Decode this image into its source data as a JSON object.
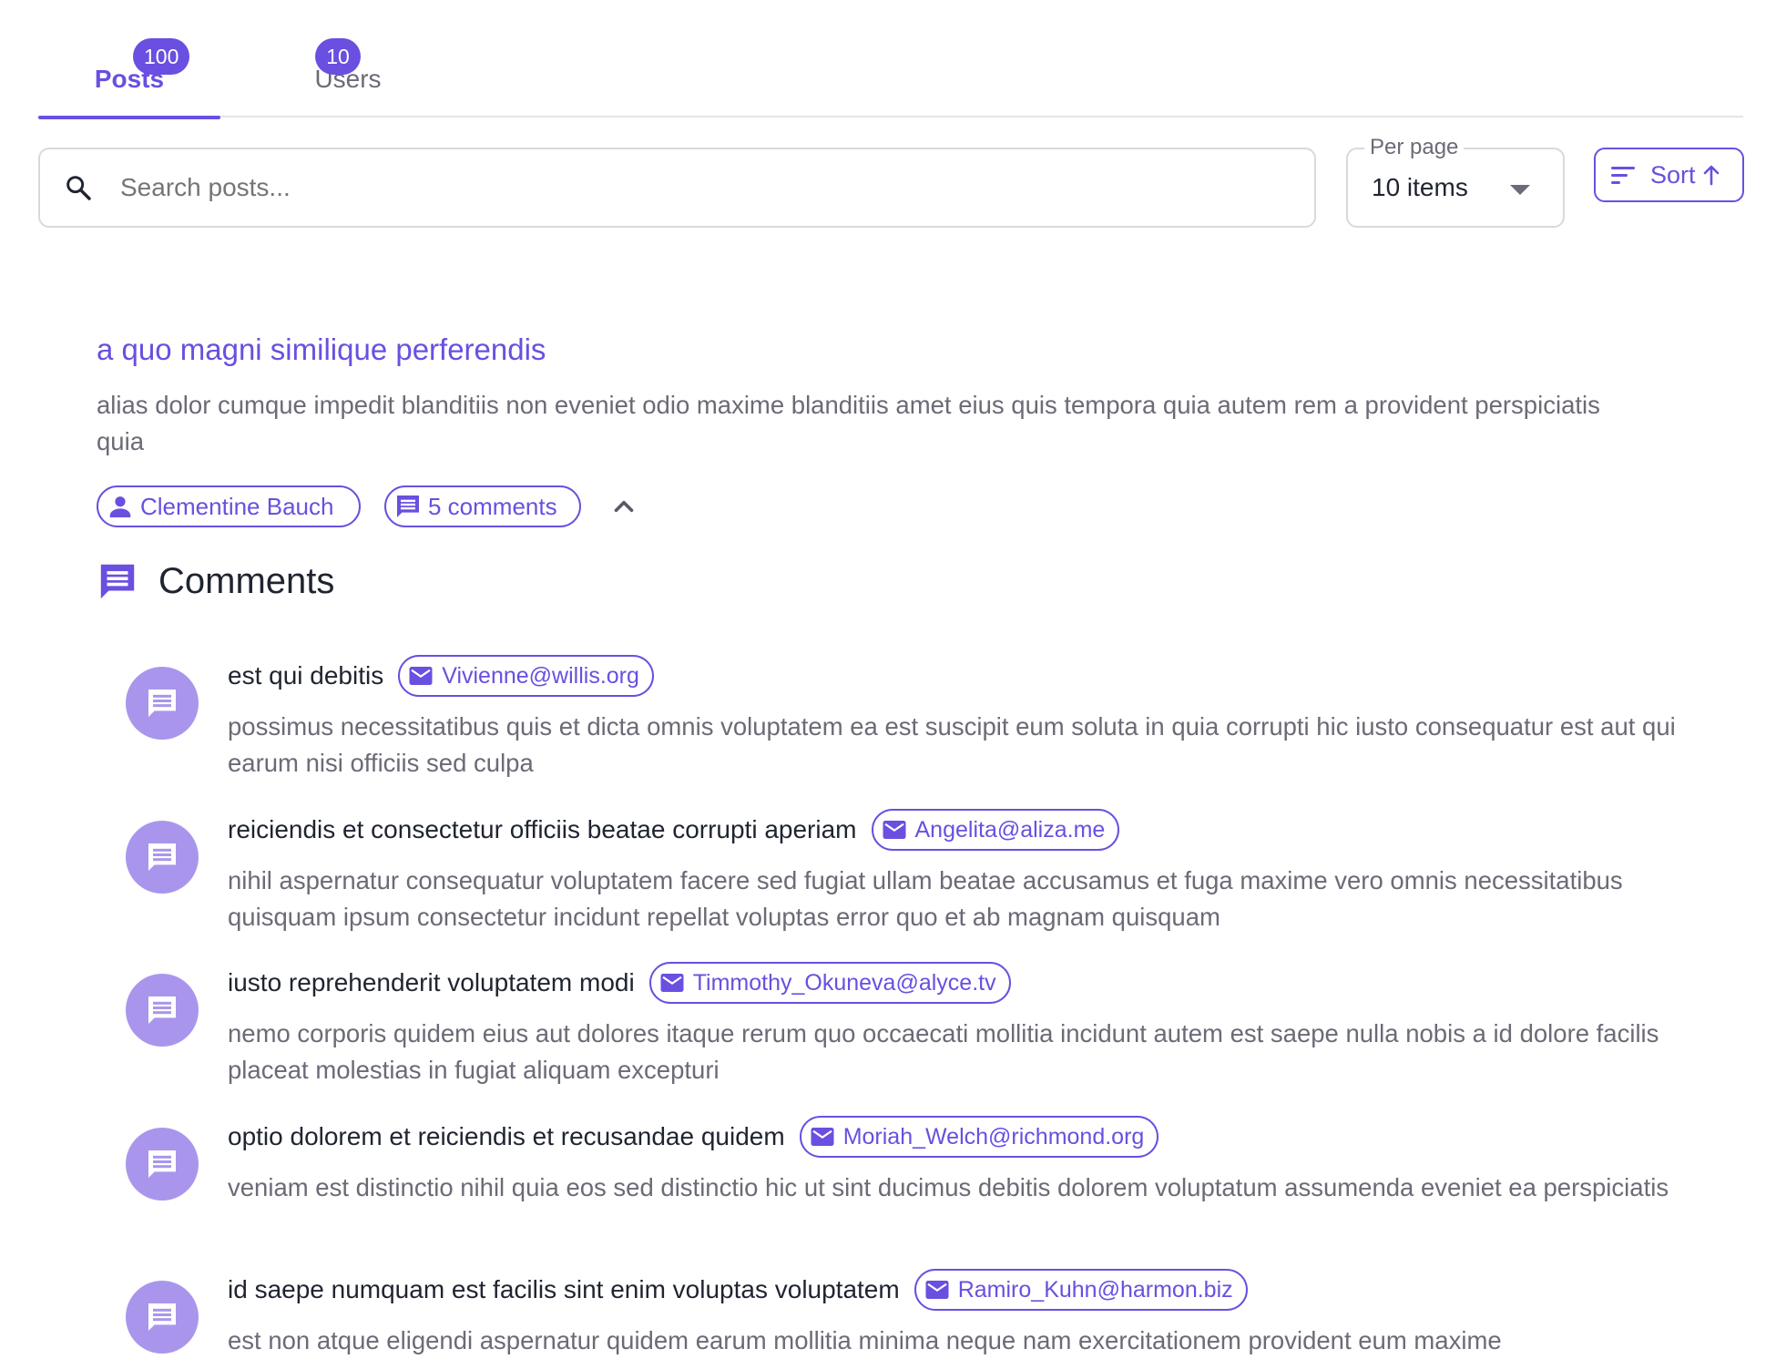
{
  "tabs": {
    "posts": {
      "label": "Posts",
      "badge": "100"
    },
    "users": {
      "label": "Users",
      "badge": "10"
    }
  },
  "search": {
    "placeholder": "Search posts..."
  },
  "per_page": {
    "label": "Per page",
    "value": "10 items"
  },
  "sort": {
    "label": "Sort"
  },
  "post": {
    "title": "a quo magni similique perferendis",
    "body": "alias dolor cumque impedit blanditiis non eveniet odio maxime blanditiis amet eius quis tempora quia autem rem a provident perspiciatis quia",
    "author": "Clementine Bauch",
    "comments_count": "5 comments"
  },
  "comments_section": {
    "heading": "Comments",
    "items": [
      {
        "name": "est qui debitis",
        "email": "Vivienne@willis.org",
        "body": "possimus necessitatibus quis et dicta omnis voluptatem ea est suscipit eum soluta in quia corrupti hic iusto consequatur est aut qui earum nisi officiis sed culpa"
      },
      {
        "name": "reiciendis et consectetur officiis beatae corrupti aperiam",
        "email": "Angelita@aliza.me",
        "body": "nihil aspernatur consequatur voluptatem facere sed fugiat ullam beatae accusamus et fuga maxime vero omnis necessitatibus quisquam ipsum consectetur incidunt repellat voluptas error quo et ab magnam quisquam"
      },
      {
        "name": "iusto reprehenderit voluptatem modi",
        "email": "Timmothy_Okuneva@alyce.tv",
        "body": "nemo corporis quidem eius aut dolores itaque rerum quo occaecati mollitia incidunt autem est saepe nulla nobis a id dolore facilis placeat molestias in fugiat aliquam excepturi"
      },
      {
        "name": "optio dolorem et reiciendis et recusandae quidem",
        "email": "Moriah_Welch@richmond.org",
        "body": "veniam est distinctio nihil quia eos sed distinctio hic ut sint ducimus debitis dolorem voluptatum assumenda eveniet ea perspiciatis"
      },
      {
        "name": "id saepe numquam est facilis sint enim voluptas voluptatem",
        "email": "Ramiro_Kuhn@harmon.biz",
        "body": "est non atque eligendi aspernatur quidem earum mollitia minima neque nam exercitationem provident eum maxime"
      }
    ]
  },
  "colors": {
    "accent": "#6a4fe0",
    "avatar_bg": "#a996ec",
    "muted_text": "#6b6b77"
  },
  "icons": {
    "search": "search-icon",
    "sort": "sort-icon",
    "person": "person-icon",
    "comment": "comment-icon",
    "email": "email-icon",
    "chevron": "chevron-up-icon"
  }
}
